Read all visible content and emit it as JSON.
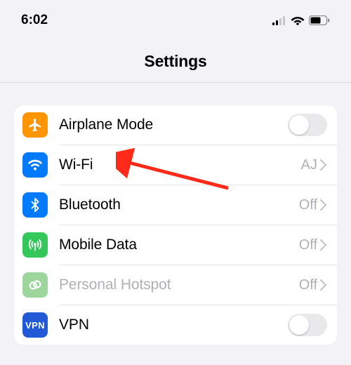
{
  "status": {
    "time": "6:02"
  },
  "header": {
    "title": "Settings"
  },
  "rows": {
    "airplane": {
      "label": "Airplane Mode"
    },
    "wifi": {
      "label": "Wi-Fi",
      "value": "AJ"
    },
    "bluetooth": {
      "label": "Bluetooth",
      "value": "Off"
    },
    "mobile": {
      "label": "Mobile Data",
      "value": "Off"
    },
    "hotspot": {
      "label": "Personal Hotspot",
      "value": "Off"
    },
    "vpn": {
      "label": "VPN",
      "icon_text": "VPN"
    }
  }
}
